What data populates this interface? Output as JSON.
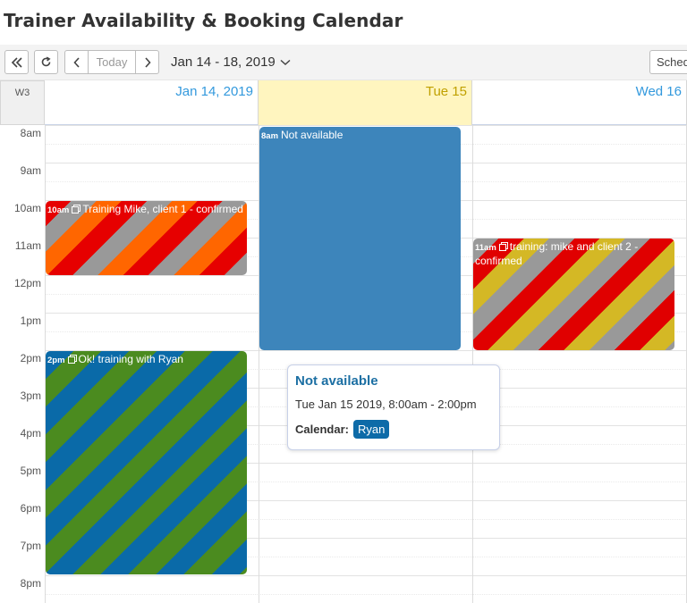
{
  "page": {
    "title": "Trainer Availability & Booking Calendar"
  },
  "toolbar": {
    "today_label": "Today",
    "date_range": "Jan 14 - 18, 2019",
    "view_button": "Schedule"
  },
  "calendar": {
    "week_label": "W3",
    "days": [
      {
        "label": "Jan 14, 2019",
        "is_today": false
      },
      {
        "label": "Tue 15",
        "is_today": true
      },
      {
        "label": "Wed 16",
        "is_today": false
      }
    ],
    "hours": [
      "8am",
      "9am",
      "10am",
      "11am",
      "12pm",
      "1pm",
      "2pm",
      "3pm",
      "4pm",
      "5pm",
      "6pm",
      "7pm",
      "8pm"
    ]
  },
  "events": [
    {
      "id": "mon-am",
      "time": "10am",
      "title": "Training Mike, client 1 - confirmed",
      "recurring": true,
      "colors": [
        "#e60000",
        "#999999",
        "#ff6600"
      ]
    },
    {
      "id": "mon-pm",
      "time": "2pm",
      "title": "Ok! training with Ryan",
      "recurring": true,
      "colors": [
        "#0a6aa8",
        "#4b8b1f"
      ]
    },
    {
      "id": "tue",
      "time": "8am",
      "title": "Not available",
      "recurring": false,
      "colors": [
        "#3d85bb"
      ]
    },
    {
      "id": "wed",
      "time": "11am",
      "title": "training: mike and client 2 - confirmed",
      "recurring": true,
      "colors": [
        "#999999",
        "#e00000",
        "#d4b825"
      ]
    }
  ],
  "popover": {
    "title": "Not available",
    "time": "Tue Jan 15 2019, 8:00am - 2:00pm",
    "calendar_label": "Calendar:",
    "calendar_value": "Ryan"
  },
  "colors": {
    "accent": "#3399dd",
    "today_bg": "#fff5bf",
    "today_text": "#c0a000",
    "chip": "#0e6ba8"
  }
}
